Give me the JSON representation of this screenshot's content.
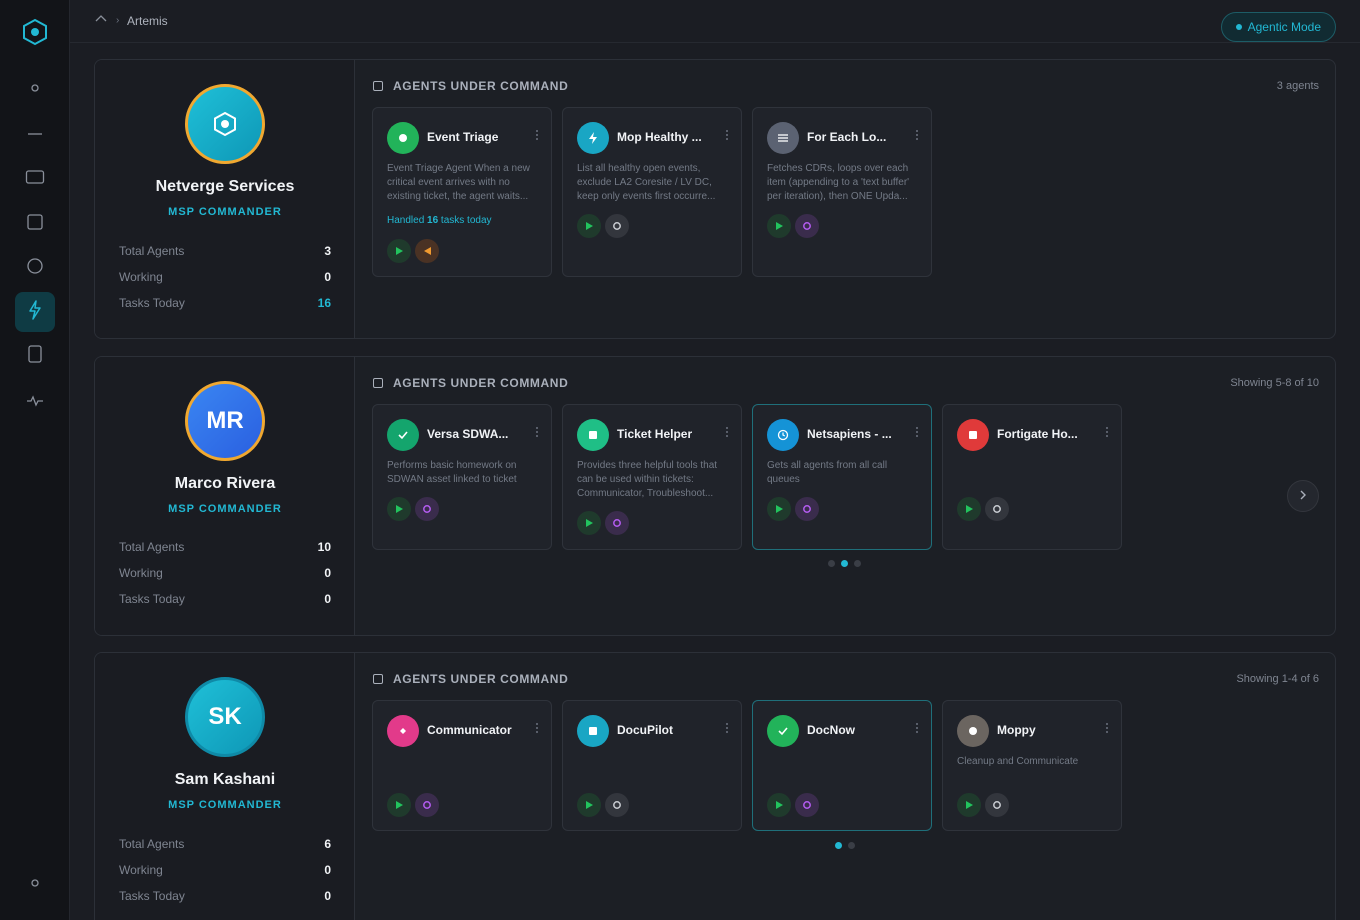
{
  "breadcrumb": {
    "current": "Artemis"
  },
  "header": {
    "agentic_mode_label": "Agentic Mode"
  },
  "sections": [
    {
      "commander": {
        "name": "Netverge Services",
        "initials": "",
        "role": "MSP COMMANDER",
        "stats": [
          {
            "label": "Total Agents",
            "value": "3"
          },
          {
            "label": "Working",
            "value": "0"
          },
          {
            "label": "Tasks Today",
            "value": "16"
          }
        ]
      },
      "agents_title": "AGENTS UNDER COMMAND",
      "agents_count": "3 agents",
      "agents": [
        {
          "title": "Event Triage",
          "desc": "Event Triage Agent When a new critical event arrives with no existing ticket, the agent waits...",
          "handled_prefix": "Handled ",
          "handled_count": "16",
          "handled_suffix": " tasks today",
          "icon": "dot-icon",
          "color": "#22b35a"
        },
        {
          "title": "Mop Healthy ...",
          "desc": "List all healthy open events, exclude LA2 Coresite / LV DC, keep only events first occurre...",
          "icon": "bolt-icon",
          "color": "#19a6c4"
        },
        {
          "title": "For Each Lo...",
          "desc": "Fetches CDRs, loops over each item (appending to a 'text buffer' per iteration), then ONE Upda...",
          "icon": "list-icon",
          "color": "#5b6272"
        }
      ]
    },
    {
      "commander": {
        "name": "Marco Rivera",
        "initials": "MR",
        "role": "MSP COMMANDER",
        "stats": [
          {
            "label": "Total Agents",
            "value": "10"
          },
          {
            "label": "Working",
            "value": "0"
          },
          {
            "label": "Tasks Today",
            "value": "0"
          }
        ]
      },
      "agents_title": "AGENTS UNDER COMMAND",
      "agents_count": "Showing 5-8 of 10",
      "agents": [
        {
          "title": "Versa SDWA...",
          "desc": "Performs basic homework on SDWAN asset linked to ticket",
          "icon": "check-icon",
          "color": "#14a56d"
        },
        {
          "title": "Ticket Helper",
          "desc": "Provides three helpful tools that can be used within tickets: Communicator, Troubleshoot...",
          "icon": "square-icon",
          "color": "#1fbf86"
        },
        {
          "title": "Netsapiens - ...",
          "desc": "Gets all agents from all call queues",
          "icon": "clock-icon",
          "color": "#1593d6"
        },
        {
          "title": "Fortigate Ho...",
          "desc": "",
          "icon": "square-icon",
          "color": "#e03a3a"
        }
      ]
    },
    {
      "commander": {
        "name": "Sam Kashani",
        "initials": "SK",
        "role": "MSP COMMANDER",
        "stats": [
          {
            "label": "Total Agents",
            "value": "6"
          },
          {
            "label": "Working",
            "value": "0"
          },
          {
            "label": "Tasks Today",
            "value": "0"
          }
        ]
      },
      "agents_title": "AGENTS UNDER COMMAND",
      "agents_count": "Showing 1-4 of 6",
      "agents": [
        {
          "title": "Communicator",
          "desc": "",
          "icon": "spark-icon",
          "color": "#e23a8a"
        },
        {
          "title": "DocuPilot",
          "desc": "",
          "icon": "square-icon",
          "color": "#19a6c4"
        },
        {
          "title": "DocNow",
          "desc": "",
          "icon": "check-icon",
          "color": "#22b35a"
        },
        {
          "title": "Moppy",
          "desc": "Cleanup and Communicate",
          "icon": "dot-icon",
          "color": "#6b6560"
        }
      ]
    }
  ]
}
